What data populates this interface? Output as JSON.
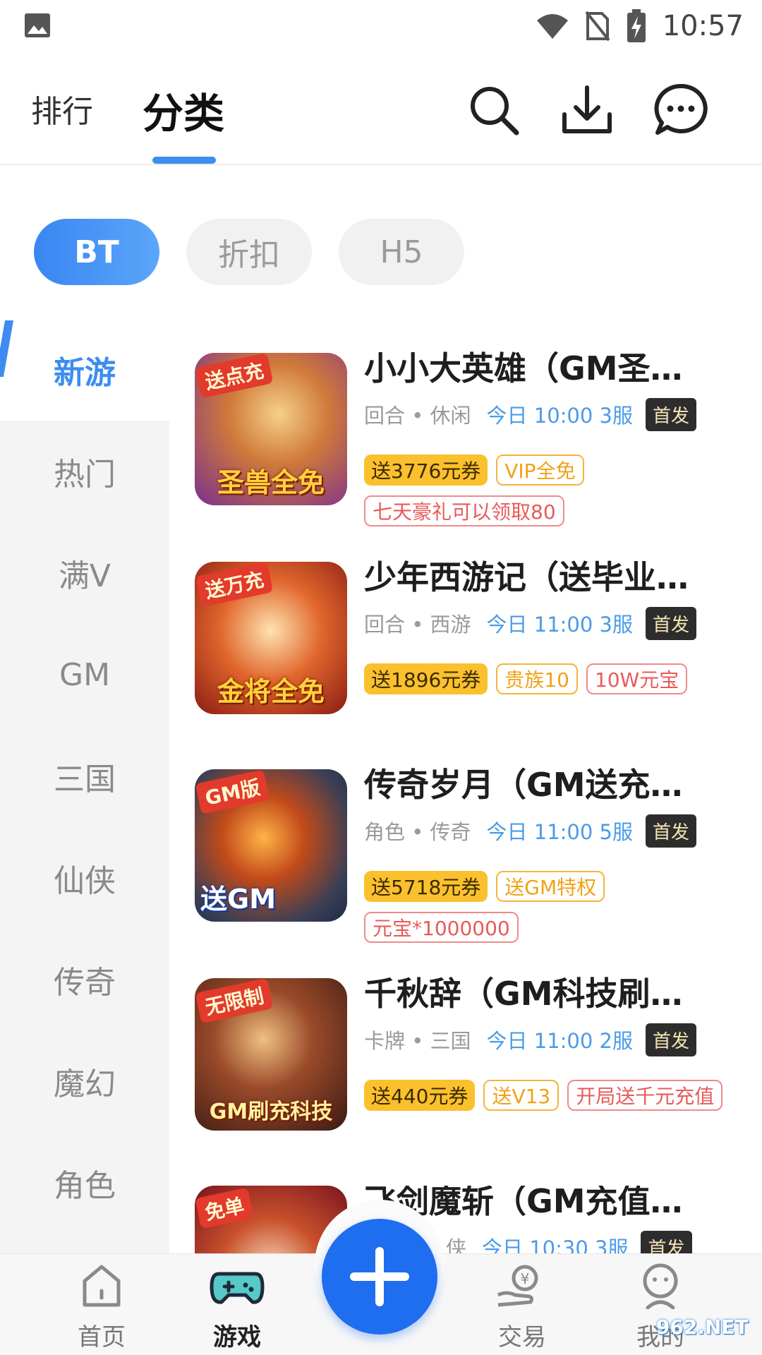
{
  "status_bar": {
    "time": "10:57"
  },
  "header": {
    "tab_rank": "排行",
    "tab_category": "分类"
  },
  "filters": [
    {
      "label": "BT",
      "active": true
    },
    {
      "label": "折扣",
      "active": false
    },
    {
      "label": "H5",
      "active": false
    }
  ],
  "sidebar": {
    "items": [
      "新游",
      "热门",
      "满V",
      "GM",
      "三国",
      "仙侠",
      "传奇",
      "魔幻",
      "角色"
    ],
    "active_index": 0
  },
  "games": [
    {
      "name": "小小大英雄（GM圣…",
      "genre": "回合 • 休闲",
      "schedule": "今日 10:00 3服",
      "first_release": "首发",
      "thumb_badge": "送点充",
      "thumb_banner": "圣兽全免",
      "tags": [
        {
          "text": "送3776元券",
          "style": "gold"
        },
        {
          "text": "VIP全免",
          "style": "orange"
        },
        {
          "text": "七天豪礼可以领取80",
          "style": "red"
        }
      ]
    },
    {
      "name": "少年西游记（送毕业…",
      "genre": "回合 • 西游",
      "schedule": "今日 11:00 3服",
      "first_release": "首发",
      "thumb_badge": "送万充",
      "thumb_banner": "金将全免",
      "tags": [
        {
          "text": "送1896元券",
          "style": "gold"
        },
        {
          "text": "贵族10",
          "style": "orange"
        },
        {
          "text": "10W元宝",
          "style": "red"
        }
      ]
    },
    {
      "name": "传奇岁月（GM送充…",
      "genre": "角色 • 传奇",
      "schedule": "今日 11:00 5服",
      "first_release": "首发",
      "thumb_badge": "GM版",
      "thumb_banner": "送GM",
      "tags": [
        {
          "text": "送5718元券",
          "style": "gold"
        },
        {
          "text": "送GM特权",
          "style": "orange"
        },
        {
          "text": "元宝*1000000",
          "style": "red"
        }
      ]
    },
    {
      "name": "千秋辞（GM科技刷…",
      "genre": "卡牌 • 三国",
      "schedule": "今日 11:00 2服",
      "first_release": "首发",
      "thumb_badge": "无限制",
      "thumb_banner": "GM刷充科技",
      "tags": [
        {
          "text": "送440元券",
          "style": "gold"
        },
        {
          "text": "送V13",
          "style": "orange"
        },
        {
          "text": "开局送千元充值",
          "style": "red"
        }
      ]
    },
    {
      "name": "飞剑魔斩（GM充值…",
      "genre": "侠",
      "schedule": "今日 10:30 3服",
      "first_release": "首发",
      "thumb_badge": "免单",
      "thumb_banner": "",
      "tags": []
    }
  ],
  "bottom_nav": [
    {
      "label": "首页",
      "icon": "home-icon",
      "active": false
    },
    {
      "label": "游戏",
      "icon": "gamepad-icon",
      "active": true
    },
    {
      "label": "交易",
      "icon": "trade-icon",
      "active": false
    },
    {
      "label": "我的",
      "icon": "profile-icon",
      "active": false
    }
  ],
  "watermark": "962.NET",
  "colors": {
    "accent": "#3d8cf2",
    "fab": "#1f6ef0",
    "gold_tag": "#fbc02d"
  }
}
